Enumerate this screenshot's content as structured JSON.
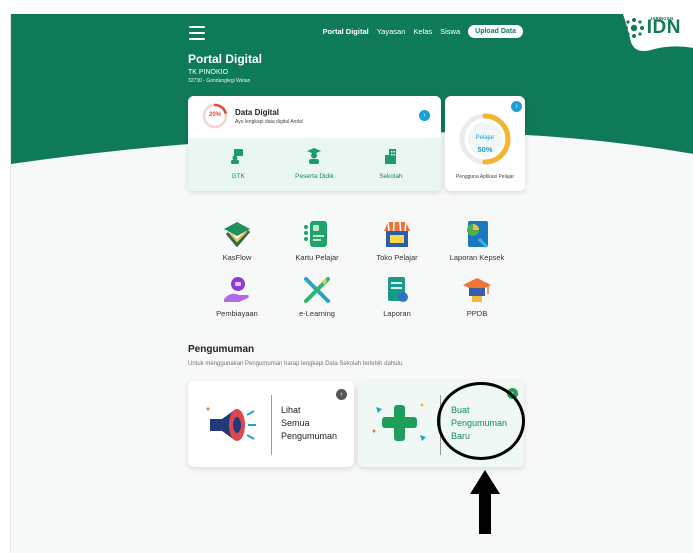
{
  "header": {
    "nav": [
      "Portal Digital",
      "Yayasan",
      "Kelas",
      "Siswa"
    ],
    "upload_label": "Upload Data",
    "logo_small": "JARINGAN",
    "logo_big": "IDN"
  },
  "school": {
    "portal_title": "Portal Digital",
    "name": "TK PINOKIO",
    "address": "32730 - Gondanglegi Wetan"
  },
  "data_digital": {
    "percent": "20%",
    "progress": 0.2,
    "title": "Data Digital",
    "subtitle": "Ayo lengkapi data digital Anda!",
    "items": [
      "GTK",
      "Peserta Didik",
      "Sekolah"
    ]
  },
  "pelajar": {
    "label": "Pelajar",
    "percent": "50%",
    "progress": 0.5,
    "caption": "Pengguna Aplikasi Pelajar"
  },
  "menu": [
    {
      "label": "KasFlow",
      "icon": "kasflow-icon"
    },
    {
      "label": "Kartu Pelajar",
      "icon": "student-card-icon"
    },
    {
      "label": "Toko Pelajar",
      "icon": "store-icon"
    },
    {
      "label": "Laporan Kepsek",
      "icon": "report-chart-icon"
    },
    {
      "label": "Pembiayaan",
      "icon": "financing-icon"
    },
    {
      "label": "e-Learning",
      "icon": "elearning-icon"
    },
    {
      "label": "Laporan",
      "icon": "report-icon"
    },
    {
      "label": "PPDB",
      "icon": "graduation-icon"
    }
  ],
  "announcement": {
    "title": "Pengumuman",
    "subtitle": "Untuk menggunakan Pengumuman harap lengkapi Data Sekolah terlebih dahulu.",
    "view_all": [
      "Lihat",
      "Semua",
      "Pengumuman"
    ],
    "create": [
      "Buat",
      "Pengumuman",
      "Baru"
    ]
  },
  "colors": {
    "brand_green": "#0f7a5a",
    "accent_blue": "#1aa0d8",
    "alert_red": "#e04a3a",
    "highlight": "#000000"
  }
}
